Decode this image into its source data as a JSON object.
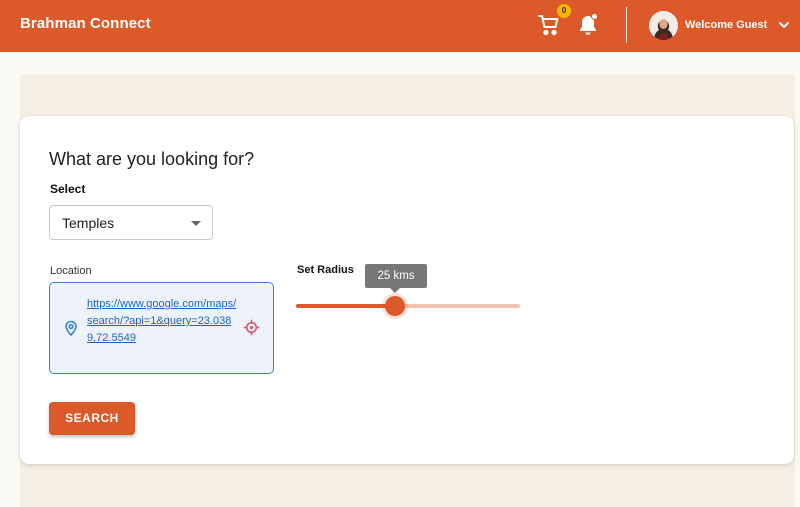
{
  "header": {
    "brand": "Brahman Connect",
    "cart_icon": "cart-icon",
    "cart_count": "0",
    "bell_icon": "bell-icon",
    "user_greeting": "Welcome Guest",
    "chevron_icon": "chevron-down-icon"
  },
  "search_card": {
    "heading": "What are you looking for?",
    "select_label": "Select",
    "select_value": "Temples",
    "location_label": "Location",
    "location_value": "https://www.google.com/maps/search/?api=1&query=23.0389,72.5549",
    "radius_label": "Set Radius",
    "radius_tooltip": "25 kms",
    "radius_fraction": 0.44,
    "search_button": "SEARCH"
  },
  "colors": {
    "accent": "#dc5a2a",
    "page_background": "#fbf9f3",
    "band_background": "#f6f0e4",
    "link": "#1a64c8",
    "badge": "#f5b800"
  }
}
